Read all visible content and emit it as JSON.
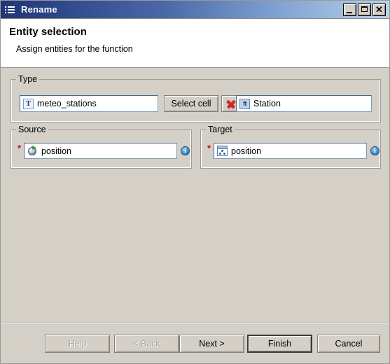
{
  "window": {
    "title": "Rename",
    "title_icon": "list-icon",
    "controls": {
      "minimize": "minimize-icon",
      "maximize": "maximize-icon",
      "close": "✕"
    }
  },
  "header": {
    "title": "Entity selection",
    "subtitle": "Assign entities for the function"
  },
  "type_group": {
    "label": "Type",
    "type_field": {
      "icon": "type-t-icon",
      "icon_text": "T",
      "value": "meteo_stations"
    },
    "select_cell_button": "Select cell",
    "clear_button_icon": "red-x-delete-icon",
    "station_field": {
      "icon": "feature-type-icon",
      "icon_text": "ft",
      "value": "Station"
    }
  },
  "source_group": {
    "label": "Source",
    "required_marker": "*",
    "field": {
      "icon": "geometry-sphere-icon",
      "value": "position"
    },
    "info_icon": "info-icon",
    "info_glyph": "i"
  },
  "target_group": {
    "label": "Target",
    "required_marker": "*",
    "field": {
      "icon": "attribute-grid-icon",
      "value": "position"
    },
    "info_icon": "info-icon",
    "info_glyph": "i"
  },
  "footer": {
    "help": "Help",
    "back": "< Back",
    "next": "Next >",
    "finish": "Finish",
    "cancel": "Cancel"
  },
  "colors": {
    "titlebar_start": "#1f3576",
    "titlebar_end": "#b9d2ec",
    "dialog_background": "#d4d0c8",
    "header_background": "#ffffff",
    "required_red": "#d0021b",
    "accent_blue": "#2f5f9e"
  }
}
